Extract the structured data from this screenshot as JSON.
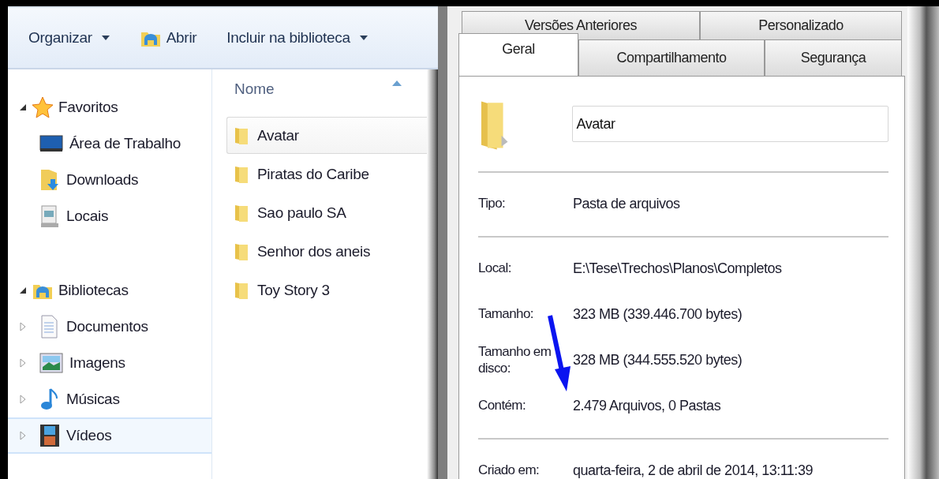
{
  "toolbar": [
    {
      "label": "Organizar",
      "kind": "menu"
    },
    {
      "label": "Abrir",
      "kind": "button"
    },
    {
      "label": "Incluir na biblioteca",
      "kind": "menu"
    }
  ],
  "sidebar": {
    "groups": [
      {
        "label": "Favoritos",
        "expanded": true,
        "children": [
          {
            "label": "Área de Trabalho",
            "selected": false
          },
          {
            "label": "Downloads",
            "selected": false
          },
          {
            "label": "Locais",
            "selected": false
          }
        ]
      },
      {
        "label": "Bibliotecas",
        "expanded": true,
        "children": [
          {
            "label": "Documentos",
            "selected": false,
            "expanded": false
          },
          {
            "label": "Imagens",
            "selected": false,
            "expanded": false
          },
          {
            "label": "Músicas",
            "selected": false,
            "expanded": false
          },
          {
            "label": "Vídeos",
            "selected": true,
            "expanded": false
          }
        ]
      }
    ]
  },
  "file_list": {
    "column": "Nome",
    "rows": [
      {
        "name": "Avatar",
        "selected": true
      },
      {
        "name": "Piratas do Caribe",
        "selected": false
      },
      {
        "name": "Sao paulo SA",
        "selected": false
      },
      {
        "name": "Senhor dos aneis",
        "selected": false
      },
      {
        "name": "Toy Story 3",
        "selected": false
      }
    ]
  },
  "properties": {
    "tab_rows": [
      [
        {
          "label": "Versões Anteriores",
          "selected": false
        },
        {
          "label": "Personalizado",
          "selected": false
        }
      ],
      [
        {
          "label": "Geral",
          "selected": true
        },
        {
          "label": "Compartilhamento",
          "selected": false
        },
        {
          "label": "Segurança",
          "selected": false
        }
      ]
    ],
    "name_field": {
      "value": "Avatar"
    },
    "sections": [
      [
        {
          "label": "Tipo:",
          "value": "Pasta de arquivos"
        }
      ],
      [
        {
          "label": "Local:",
          "value": "E:\\Tese\\Trechos\\Planos\\Completos"
        },
        {
          "label": "Tamanho:",
          "value": "323 MB (339.446.700 bytes)"
        },
        {
          "label": "Tamanho em disco:",
          "value": "328 MB (344.555.520 bytes)"
        },
        {
          "label": "Contém:",
          "value": "2.479 Arquivos, 0 Pastas"
        }
      ],
      [
        {
          "label": "Criado em:",
          "value": "quarta-feira, 2 de abril de 2014, 13:11:39"
        }
      ]
    ]
  }
}
